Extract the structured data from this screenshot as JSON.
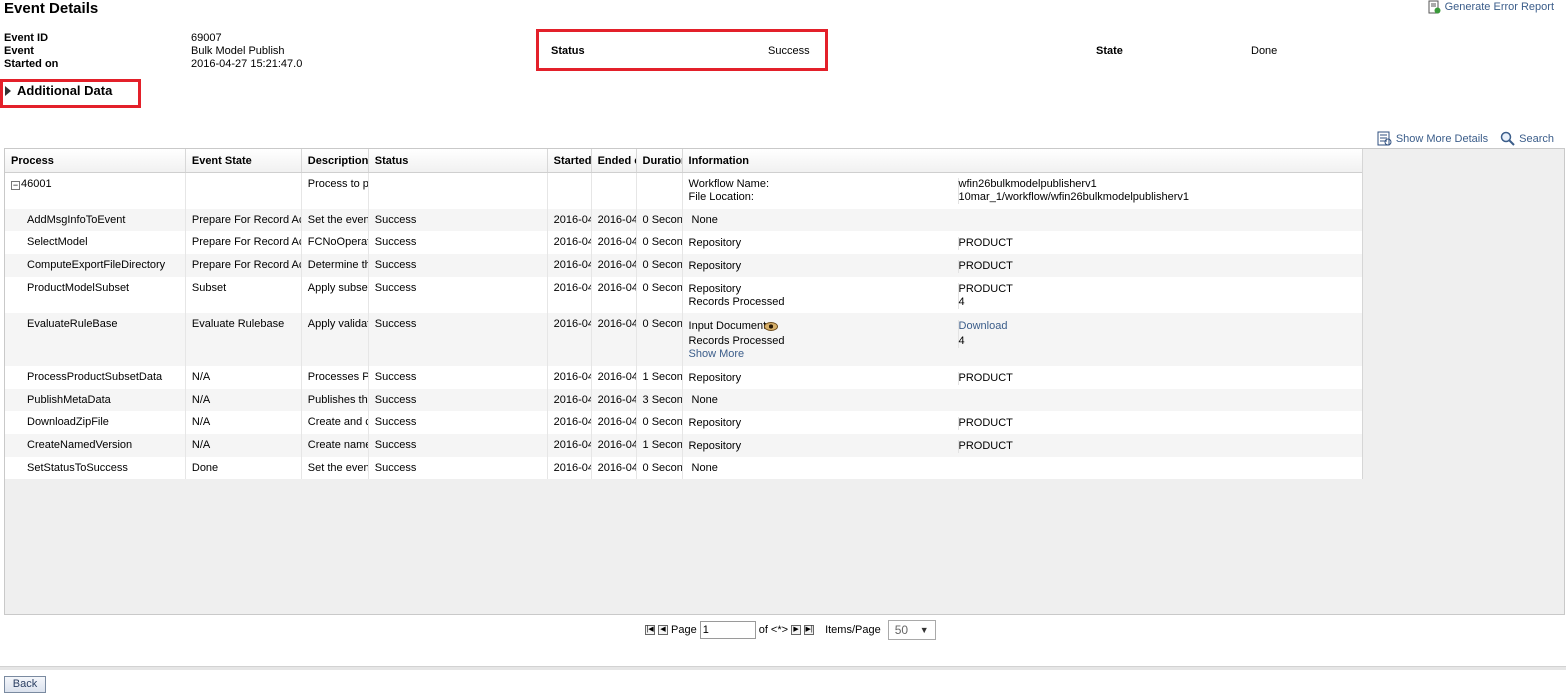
{
  "page": {
    "title": "Event Details",
    "generate_error_report": "Generate Error Report"
  },
  "event": {
    "id_label": "Event ID",
    "id": "69007",
    "event_label": "Event",
    "event": "Bulk Model Publish",
    "started_label": "Started on",
    "started": "2016-04-27 15:21:47.0",
    "status_label": "Status",
    "status": "Success",
    "state_label": "State",
    "state": "Done"
  },
  "additional_data": "Additional Data",
  "toolbar": {
    "show_more": "Show More Details",
    "search": "Search"
  },
  "grid": {
    "columns": [
      "Process",
      "Event State",
      "Description",
      "Status",
      "Started",
      "Ended on",
      "Duration",
      "Information"
    ],
    "rows": [
      {
        "process": "46001",
        "event_state": "",
        "description": "Process to p",
        "status": "",
        "started": "",
        "ended": "",
        "duration": "",
        "info": [
          {
            "k": "Workflow Name:",
            "v": "wfin26bulkmodelpublisherv1"
          },
          {
            "k": "File Location:",
            "v": "10mar_1/workflow/wfin26bulkmodelpublisherv1"
          }
        ]
      },
      {
        "process": "AddMsgInfoToEvent",
        "event_state": "Prepare For Record Ac",
        "description": "Set the even",
        "status": "Success",
        "started": "2016-04",
        "ended": "2016-04",
        "duration": "0 Secon",
        "info_text": "None"
      },
      {
        "process": "SelectModel",
        "event_state": "Prepare For Record Ac",
        "description": "FCNoOperat",
        "status": "Success",
        "started": "2016-04",
        "ended": "2016-04",
        "duration": "0 Secon",
        "info": [
          {
            "k": "Repository",
            "v": "PRODUCT"
          }
        ]
      },
      {
        "process": "ComputeExportFileDirectory",
        "event_state": "Prepare For Record Ac",
        "description": "Determine th",
        "status": "Success",
        "started": "2016-04",
        "ended": "2016-04",
        "duration": "0 Secon",
        "info": [
          {
            "k": "Repository",
            "v": "PRODUCT"
          }
        ]
      },
      {
        "process": "ProductModelSubset",
        "event_state": "Subset",
        "description": "Apply subset",
        "status": "Success",
        "started": "2016-04",
        "ended": "2016-04",
        "duration": "0 Secon",
        "info": [
          {
            "k": "Repository",
            "v": "PRODUCT"
          },
          {
            "k": "Records Processed",
            "v": "4"
          }
        ]
      },
      {
        "process": "EvaluateRuleBase",
        "event_state": "Evaluate Rulebase",
        "description": "Apply validat",
        "status": "Success",
        "started": "2016-04",
        "ended": "2016-04",
        "duration": "0 Secon",
        "info_special": {
          "input_label": "Input Document",
          "download": "Download",
          "rp_label": "Records Processed",
          "rp_value": "4",
          "show_more": "Show More"
        }
      },
      {
        "process": "ProcessProductSubsetData",
        "event_state": "N/A",
        "description": "Processes P",
        "status": "Success",
        "started": "2016-04",
        "ended": "2016-04",
        "duration": "1 Secon",
        "info": [
          {
            "k": "Repository",
            "v": "PRODUCT"
          }
        ]
      },
      {
        "process": "PublishMetaData",
        "event_state": "N/A",
        "description": "Publishes th",
        "status": "Success",
        "started": "2016-04",
        "ended": "2016-04",
        "duration": "3 Secon",
        "info_text": "None"
      },
      {
        "process": "DownloadZipFile",
        "event_state": "N/A",
        "description": "Create and c",
        "status": "Success",
        "started": "2016-04",
        "ended": "2016-04",
        "duration": "0 Secon",
        "info": [
          {
            "k": "Repository",
            "v": "PRODUCT"
          }
        ]
      },
      {
        "process": "CreateNamedVersion",
        "event_state": "N/A",
        "description": "Create name",
        "status": "Success",
        "started": "2016-04",
        "ended": "2016-04",
        "duration": "1 Secon",
        "info": [
          {
            "k": "Repository",
            "v": "PRODUCT"
          }
        ]
      },
      {
        "process": "SetStatusToSuccess",
        "event_state": "Done",
        "description": "Set the even",
        "status": "Success",
        "started": "2016-04",
        "ended": "2016-04",
        "duration": "0 Secon",
        "info_text": "None"
      }
    ]
  },
  "pager": {
    "page_label": "Page",
    "page_value": "1",
    "of_label": "of <*>",
    "items_label": "Items/Page",
    "items_value": "50"
  },
  "back": "Back"
}
